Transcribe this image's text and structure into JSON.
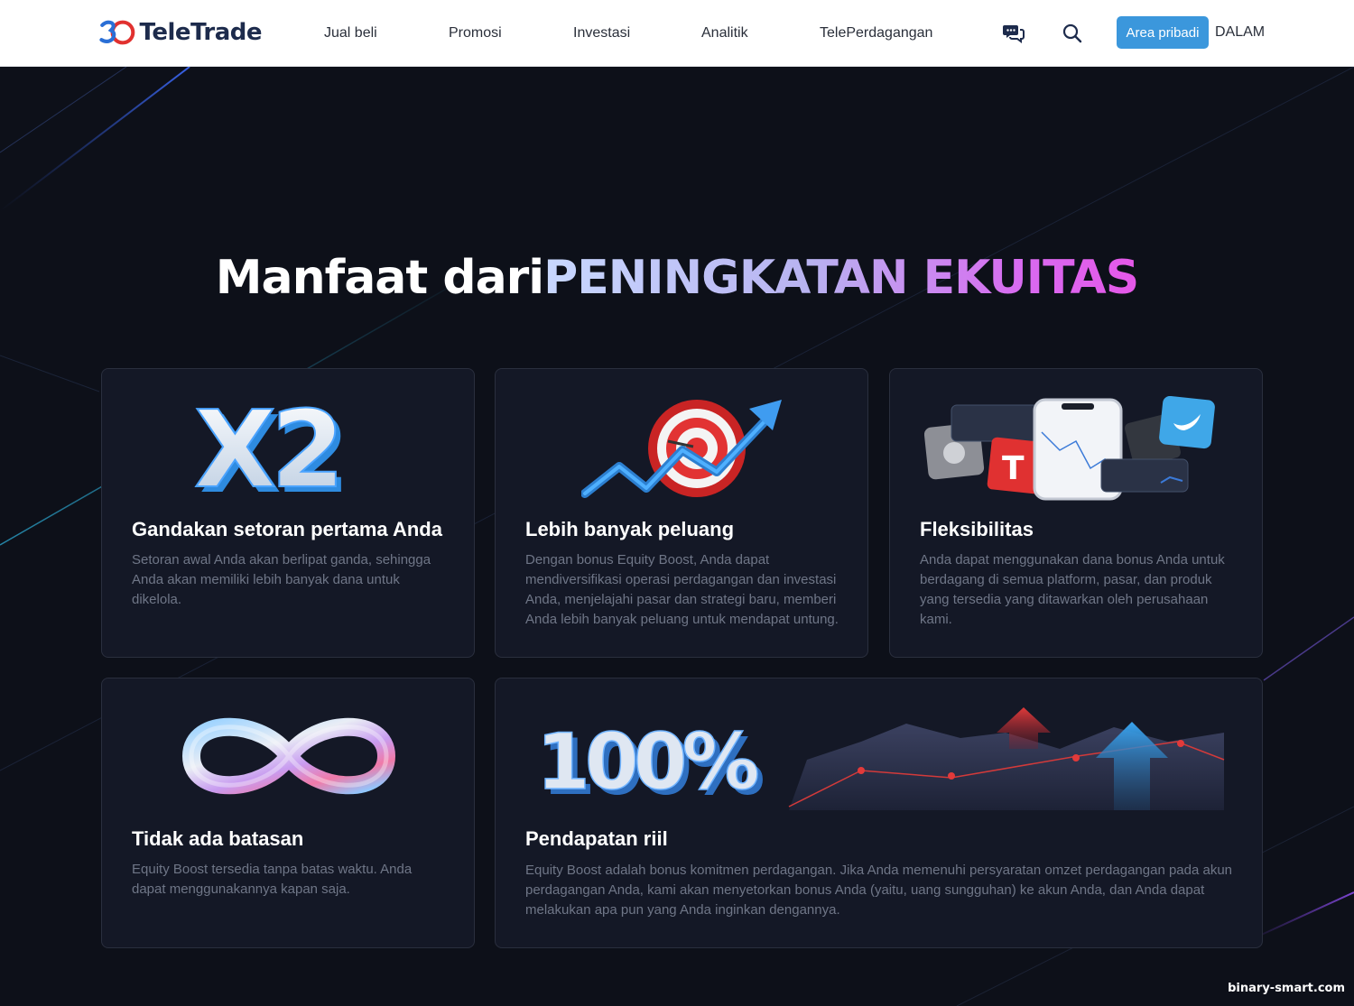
{
  "header": {
    "logo_number": "30",
    "logo_text": "TeleTrade",
    "nav": [
      "Jual beli",
      "Promosi",
      "Investasi",
      "Analitik",
      "TelePerdagangan"
    ],
    "chat_icon": "chat-bubbles-icon",
    "search_icon": "search-icon",
    "area_button": "Area pribadi",
    "login_link": "DALAM"
  },
  "hero": {
    "title_plain": "Manfaat dari",
    "title_accent": "PENINGKATAN EKUITAS"
  },
  "cards": [
    {
      "art": "x2-3d-icon",
      "art_text": "X2",
      "title": "Gandakan setoran pertama Anda",
      "text": "Setoran awal Anda akan berlipat ganda, sehingga Anda akan memiliki lebih banyak dana untuk dikelola."
    },
    {
      "art": "target-arrow-chart-icon",
      "title": "Lebih banyak peluang",
      "text": "Dengan bonus Equity Boost, Anda dapat mendiversifikasi operasi perdagangan dan investasi Anda, menjelajahi pasar dan strategi baru, memberi Anda lebih banyak peluang untuk mendapat untung."
    },
    {
      "art": "trading-platforms-collage-icon",
      "title": "Fleksibilitas",
      "text": "Anda dapat menggunakan dana bonus Anda untuk berdagang di semua platform, pasar, dan produk yang tersedia yang ditawarkan oleh perusahaan kami."
    },
    {
      "art": "infinity-3d-icon",
      "title": "Tidak ada batasan",
      "text": "Equity Boost tersedia tanpa batas waktu. Anda dapat menggunakannya kapan saja."
    },
    {
      "art": "hundred-percent-growth-chart",
      "art_text": "100%",
      "title": "Pendapatan riil",
      "text": "Equity Boost adalah bonus komitmen perdagangan. Jika Anda memenuhi persyaratan omzet perdagangan pada akun perdagangan Anda, kami akan menyetorkan bonus Anda (yaitu, uang sungguhan) ke akun Anda, dan Anda dapat melakukan apa pun yang Anda inginkan dengannya."
    }
  ],
  "watermark": "binary-smart.com"
}
